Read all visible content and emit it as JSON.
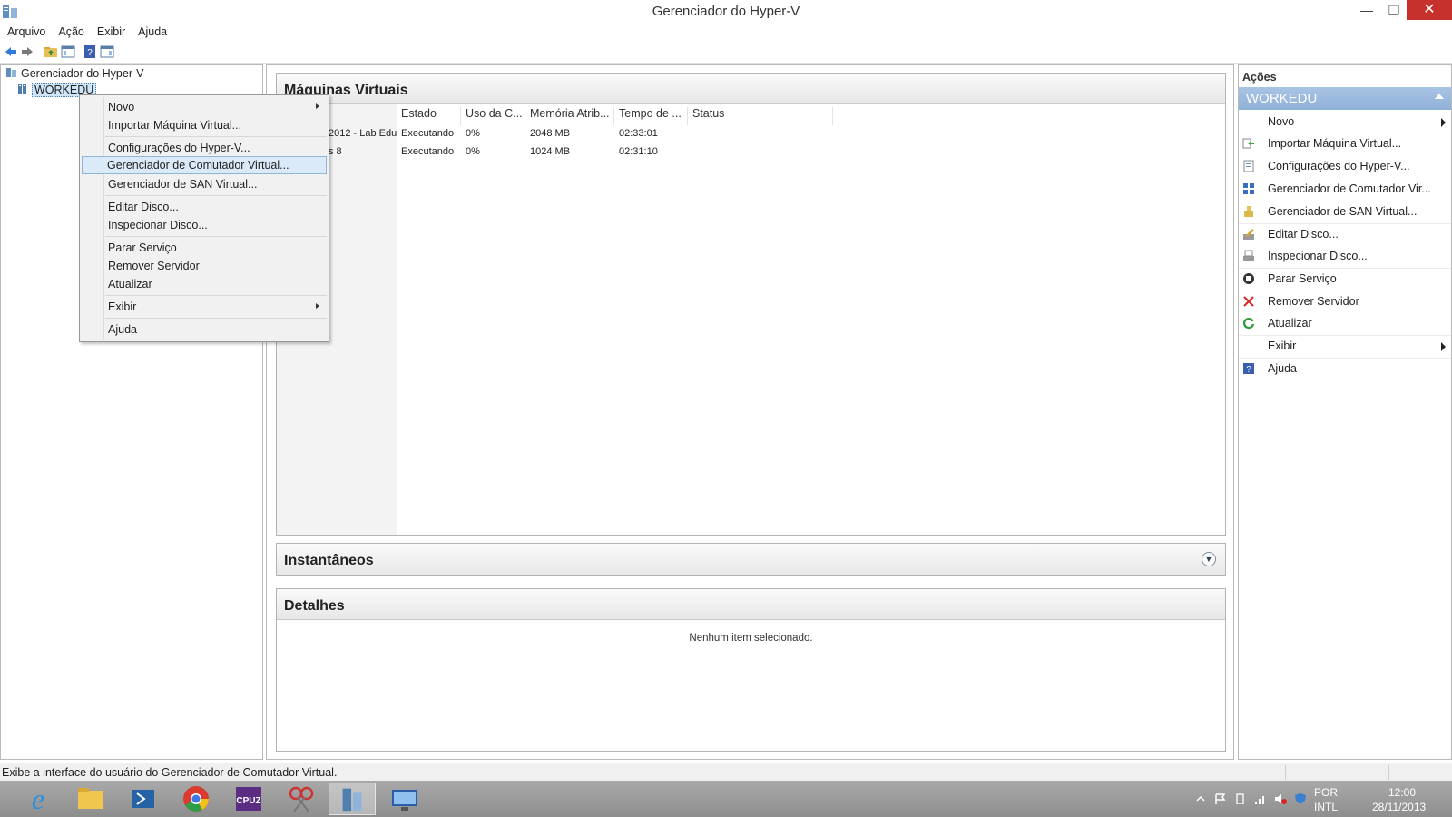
{
  "window": {
    "title": "Gerenciador do Hyper-V"
  },
  "menubar": [
    "Arquivo",
    "Ação",
    "Exibir",
    "Ajuda"
  ],
  "tree": {
    "root": "Gerenciador do Hyper-V",
    "server": "WORKEDU"
  },
  "vm_section": {
    "title": "Máquinas Virtuais",
    "columns": [
      "Estado",
      "Uso da C...",
      "Memória Atrib...",
      "Tempo de ...",
      "Status"
    ],
    "rows": [
      {
        "name": "2012 - Lab Edu",
        "state": "Executando",
        "cpu": "0%",
        "memory": "2048 MB",
        "uptime": "02:33:01",
        "status": ""
      },
      {
        "name": "s 8",
        "state": "Executando",
        "cpu": "0%",
        "memory": "1024 MB",
        "uptime": "02:31:10",
        "status": ""
      }
    ]
  },
  "snapshots_section": {
    "title": "Instantâneos"
  },
  "details_section": {
    "title": "Detalhes",
    "empty_text": "Nenhum item selecionado."
  },
  "actions": {
    "title": "Ações",
    "subhead": "WORKEDU",
    "items": [
      {
        "label": "Novo",
        "icon": "none",
        "submenu": true
      },
      {
        "label": "Importar Máquina Virtual...",
        "icon": "import-icon"
      },
      {
        "label": "Configurações do Hyper-V...",
        "icon": "settings-doc-icon"
      },
      {
        "label": "Gerenciador de Comutador Vir...",
        "icon": "switch-icon"
      },
      {
        "label": "Gerenciador de SAN Virtual...",
        "icon": "san-icon"
      },
      {
        "label": "Editar Disco...",
        "icon": "edit-disk-icon"
      },
      {
        "label": "Inspecionar Disco...",
        "icon": "inspect-disk-icon"
      },
      {
        "label": "Parar Serviço",
        "icon": "stop-icon"
      },
      {
        "label": "Remover Servidor",
        "icon": "remove-icon"
      },
      {
        "label": "Atualizar",
        "icon": "refresh-icon"
      },
      {
        "label": "Exibir",
        "icon": "none",
        "submenu": true
      },
      {
        "label": "Ajuda",
        "icon": "help-icon"
      }
    ]
  },
  "context_menu": {
    "items": [
      {
        "label": "Novo",
        "submenu": true
      },
      {
        "label": "Importar Máquina Virtual..."
      },
      {
        "label": "Configurações do Hyper-V..."
      },
      {
        "label": "Gerenciador de Comutador Virtual...",
        "active": true
      },
      {
        "label": "Gerenciador de SAN Virtual..."
      },
      {
        "label": "Editar Disco..."
      },
      {
        "label": "Inspecionar Disco..."
      },
      {
        "label": "Parar Serviço"
      },
      {
        "label": "Remover Servidor"
      },
      {
        "label": "Atualizar"
      },
      {
        "label": "Exibir",
        "submenu": true
      },
      {
        "label": "Ajuda"
      }
    ]
  },
  "statusbar": {
    "text": "Exibe a interface do usuário do Gerenciador de Comutador Virtual."
  },
  "taskbar": {
    "apps": [
      "internet-explorer",
      "file-explorer",
      "powershell",
      "chrome",
      "cpu-z",
      "snipping-tool",
      "hyper-v-manager",
      "remote-desktop"
    ],
    "language": "POR",
    "keyboard": "INTL",
    "time": "12:00",
    "date": "28/11/2013"
  },
  "colors": {
    "accent_header": "#9bb8de",
    "close_button": "#c7312b",
    "selection": "#dbeaf8"
  }
}
